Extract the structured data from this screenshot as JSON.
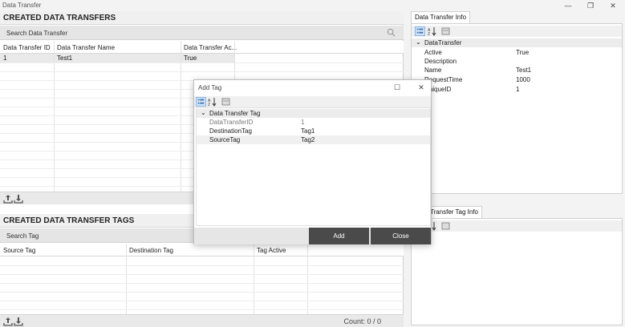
{
  "window": {
    "title": "Data Transfer",
    "minimize": "—",
    "restore": "❐",
    "close": "✕"
  },
  "transfers": {
    "title": "CREATED DATA TRANSFERS",
    "search_placeholder": "Search Data Transfer",
    "columns": [
      "Data Transfer ID",
      "Data Transfer Name",
      "Data Transfer Ac..."
    ],
    "rows": [
      {
        "id": "1",
        "name": "Test1",
        "active": "True"
      }
    ]
  },
  "tags": {
    "title": "CREATED DATA TRANSFER TAGS",
    "search_placeholder": "Search Tag",
    "columns": [
      "Source Tag",
      "Destination Tag",
      "Tag Active"
    ],
    "count": "Count: 0 / 0"
  },
  "info": {
    "tab": "Data Transfer Info",
    "category": "DataTransfer",
    "props": [
      {
        "key": "Active",
        "value": "True"
      },
      {
        "key": "Description",
        "value": ""
      },
      {
        "key": "Name",
        "value": "Test1"
      },
      {
        "key": "RequestTime",
        "value": "1000"
      },
      {
        "key": "UniqueID",
        "value": "1"
      }
    ]
  },
  "tag_info": {
    "tab": "Data Transfer Tag Info"
  },
  "dialog": {
    "title": "Add Tag",
    "category": "Data Transfer Tag",
    "props": [
      {
        "key": "DataTransferID",
        "value": "1"
      },
      {
        "key": "DestinationTag",
        "value": "Tag1"
      },
      {
        "key": "SourceTag",
        "value": "Tag2"
      }
    ],
    "add_label": "Add",
    "close_label": "Close",
    "maximize": "☐",
    "close": "✕"
  }
}
